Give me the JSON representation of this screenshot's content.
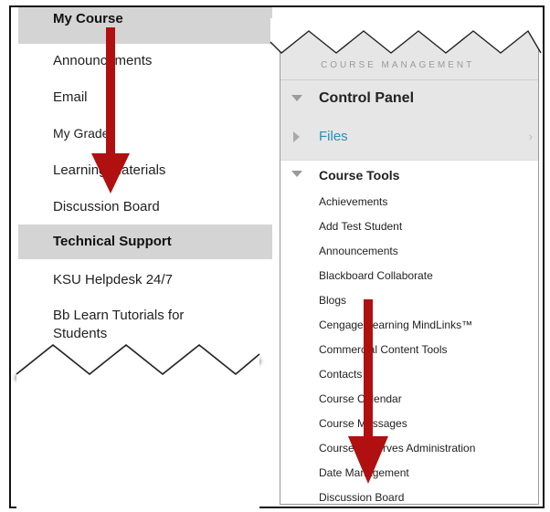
{
  "left_menu": {
    "course_heading": "My Course",
    "course_items": [
      "Announcements",
      "Email",
      "My Grades",
      "Learning Materials",
      "Discussion Board"
    ],
    "support_heading": "Technical Support",
    "support_items": [
      "KSU Helpdesk 24/7",
      "Bb Learn Tutorials for Students"
    ]
  },
  "control_panel": {
    "section_label": "COURSE MANAGEMENT",
    "title": "Control Panel",
    "files_label": "Files",
    "course_tools_label": "Course Tools",
    "tools": [
      "Achievements",
      "Add Test Student",
      "Announcements",
      "Blackboard Collaborate",
      "Blogs",
      "Cengage Learning MindLinks™",
      "Commercial Content Tools",
      "Contacts",
      "Course Calendar",
      "Course Messages",
      "Course Reserves Administration",
      "Date Management",
      "Discussion Board"
    ]
  },
  "colors": {
    "arrow": "#b01010",
    "heading_bg": "#d4d4d4",
    "link_blue": "#2a8fb5"
  },
  "icons": [
    "expanded-triangle-icon",
    "collapsed-triangle-icon",
    "chevron-right-icon",
    "red-arrow-icon"
  ]
}
